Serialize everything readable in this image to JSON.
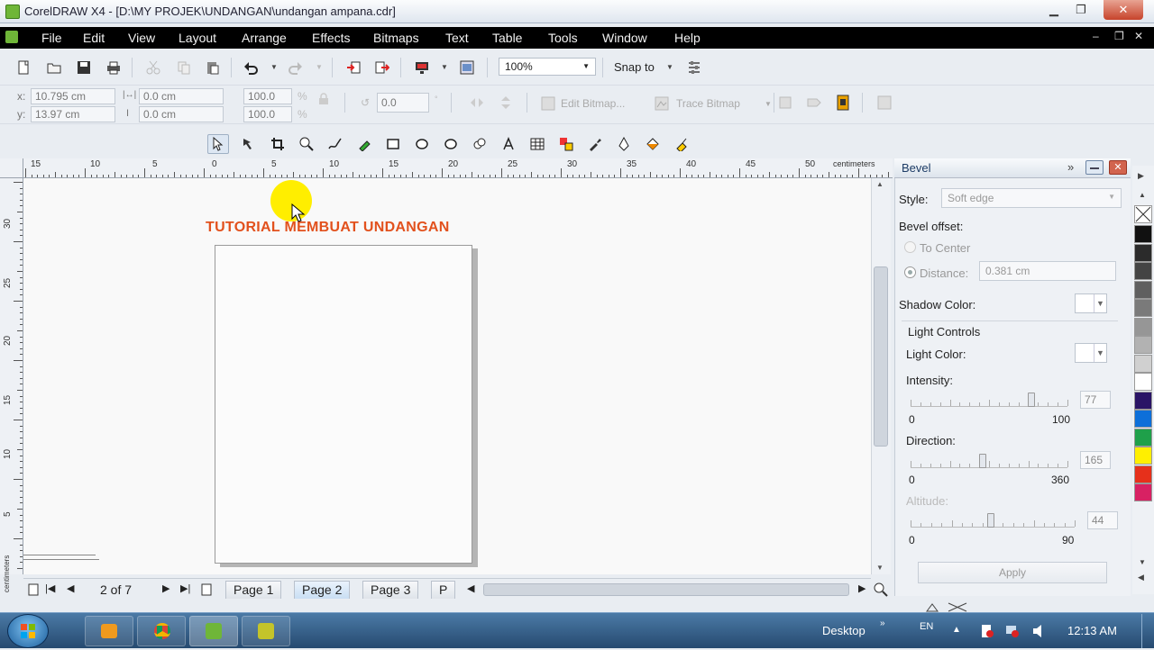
{
  "window": {
    "title": "CorelDRAW X4 - [D:\\MY PROJEK\\UNDANGAN\\undangan ampana.cdr]",
    "minimize": "▁",
    "maximize": "❐",
    "close": "✕"
  },
  "menu": {
    "items": [
      "File",
      "Edit",
      "View",
      "Layout",
      "Arrange",
      "Effects",
      "Bitmaps",
      "Text",
      "Table",
      "Tools",
      "Window",
      "Help"
    ],
    "doc_controls": [
      "‒",
      "❐",
      "✕"
    ]
  },
  "standard_toolbar": {
    "zoom": "100%",
    "snap_to": "Snap to",
    "icons": [
      "new-icon",
      "open-icon",
      "save-icon",
      "print-icon",
      "cut-icon",
      "copy-icon",
      "paste-icon",
      "undo-icon",
      "redo-icon",
      "import-icon",
      "export-icon",
      "application-launcher-icon",
      "welcome-screen-icon",
      "options-icon"
    ]
  },
  "property_bar": {
    "x_label": "x:",
    "x_value": "10.795 cm",
    "y_label": "y:",
    "y_value": "13.97 cm",
    "width_value": "0.0 cm",
    "height_value": "0.0 cm",
    "scale_x": "100.0",
    "scale_y": "100.0",
    "scale_unit": "%",
    "rotation": "0.0",
    "edit_bitmap": "Edit Bitmap...",
    "trace_bitmap": "Trace Bitmap"
  },
  "toolbox": {
    "tools": [
      "pick-tool",
      "shape-tool",
      "crop-tool",
      "zoom-tool",
      "freehand-tool",
      "smart-fill-tool",
      "rectangle-tool",
      "ellipse-tool",
      "polygon-tool",
      "basic-shapes-tool",
      "text-tool",
      "table-tool",
      "interactive-blend-tool",
      "eyedropper-tool",
      "outline-tool",
      "fill-tool",
      "interactive-fill-tool"
    ]
  },
  "rulers": {
    "horizontal": [
      "15",
      "10",
      "5",
      "0",
      "5",
      "10",
      "15",
      "20",
      "25",
      "30",
      "35",
      "40",
      "45",
      "50"
    ],
    "horizontal_unit": "centimeters",
    "vertical": [
      "30",
      "25",
      "20",
      "15",
      "10",
      "5"
    ],
    "vertical_unit": "centimeters"
  },
  "canvas": {
    "heading": "TUTORIAL MEMBUAT UNDANGAN"
  },
  "page_nav": {
    "current": "2 of 7",
    "tabs": [
      "Page 1",
      "Page 2",
      "Page 3",
      "P"
    ]
  },
  "docker": {
    "title": "Bevel",
    "style_label": "Style:",
    "style_value": "Soft edge",
    "bevel_offset_label": "Bevel offset:",
    "to_center_label": "To Center",
    "distance_label": "Distance:",
    "distance_value": "0.381 cm",
    "shadow_color_label": "Shadow Color:",
    "light_controls_label": "Light Controls",
    "light_color_label": "Light Color:",
    "intensity_label": "Intensity:",
    "intensity_value": "77",
    "intensity_min": "0",
    "intensity_max": "100",
    "direction_label": "Direction:",
    "direction_value": "165",
    "direction_min": "0",
    "direction_max": "360",
    "altitude_label": "Altitude:",
    "altitude_value": "44",
    "altitude_min": "0",
    "altitude_max": "90",
    "apply_label": "Apply"
  },
  "palette": {
    "swatches": [
      "#111111",
      "#2b2b2b",
      "#444444",
      "#5f5f5f",
      "#7a7a7a",
      "#969696",
      "#b2b2b2",
      "#d0d0d0",
      "#ffffff",
      "#2a1466",
      "#0d6fd9",
      "#1fa04a",
      "#ffef00",
      "#e6301b",
      "#d82163"
    ]
  },
  "taskbar": {
    "desktop_label": "Desktop",
    "language": "EN",
    "time": "12:13 AM"
  }
}
